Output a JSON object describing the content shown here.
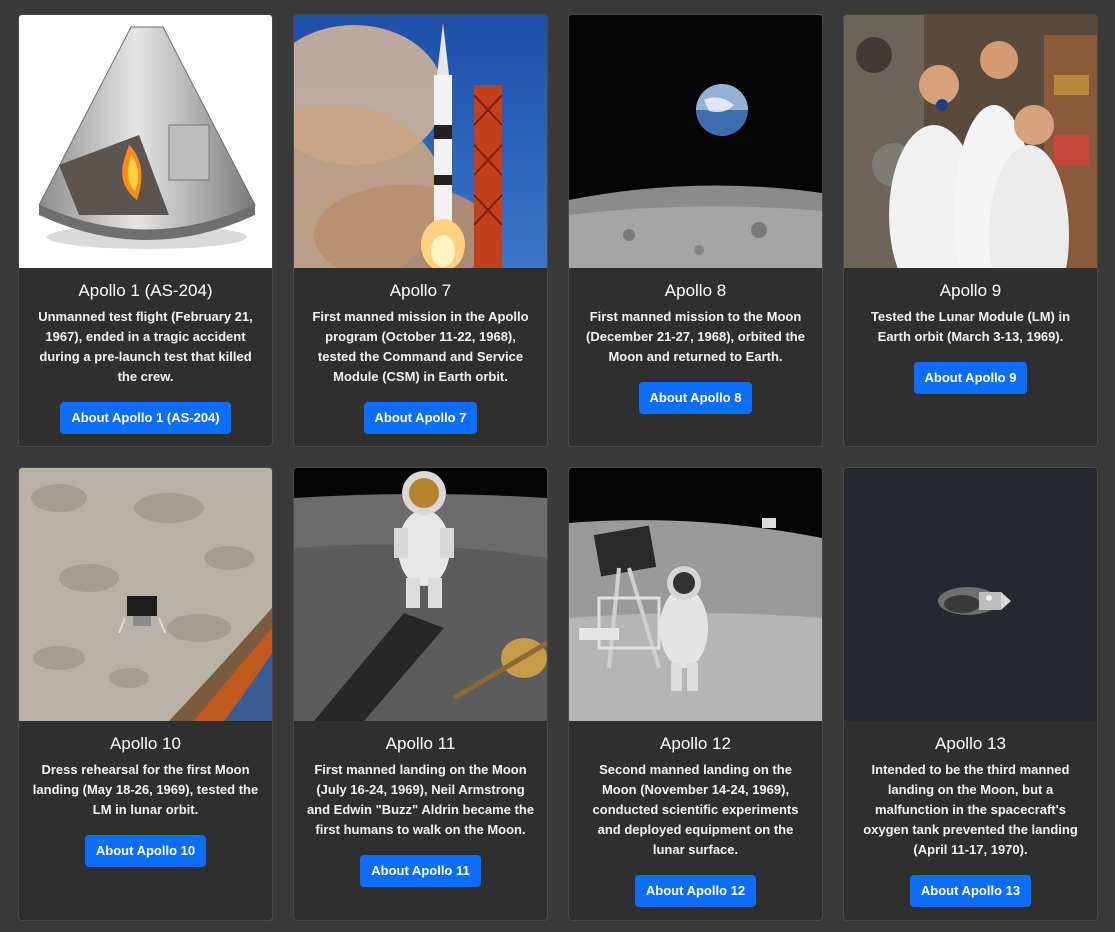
{
  "cards": [
    {
      "title": "Apollo 1 (AS-204)",
      "description": "Unmanned test flight (February 21, 1967), ended in a tragic accident during a pre-launch test that killed the crew.",
      "button": "About Apollo 1 (AS-204)",
      "image": "command-module-cutaway-image"
    },
    {
      "title": "Apollo 7",
      "description": "First manned mission in the Apollo program (October 11-22, 1968), tested the Command and Service Module (CSM) in Earth orbit.",
      "button": "About Apollo 7",
      "image": "rocket-launch-image"
    },
    {
      "title": "Apollo 8",
      "description": "First manned mission to the Moon (December 21-27, 1968), orbited the Moon and returned to Earth.",
      "button": "About Apollo 8",
      "image": "earthrise-image"
    },
    {
      "title": "Apollo 9",
      "description": "Tested the Lunar Module (LM) in Earth orbit (March 3-13, 1969).",
      "button": "About Apollo 9",
      "image": "crew-photo-image"
    },
    {
      "title": "Apollo 10",
      "description": "Dress rehearsal for the first Moon landing (May 18-26, 1969), tested the LM in lunar orbit.",
      "button": "About Apollo 10",
      "image": "lunar-module-orbit-image"
    },
    {
      "title": "Apollo 11",
      "description": "First manned landing on the Moon (July 16-24, 1969), Neil Armstrong and Edwin \"Buzz\" Aldrin became the first humans to walk on the Moon.",
      "button": "About Apollo 11",
      "image": "astronaut-moonwalk-image"
    },
    {
      "title": "Apollo 12",
      "description": "Second manned landing on the Moon (November 14-24, 1969), conducted scientific experiments and deployed equipment on the lunar surface.",
      "button": "About Apollo 12",
      "image": "surveyor-astronaut-image"
    },
    {
      "title": "Apollo 13",
      "description": "Intended to be the third manned landing on the Moon, but a malfunction in the spacecraft's oxygen tank prevented the landing (April 11-17, 1970).",
      "button": "About Apollo 13",
      "image": "service-module-image"
    }
  ],
  "colors": {
    "page_bg": "#3a3a3a",
    "card_bg": "#2f2f2f",
    "button_bg": "#0d6efd"
  }
}
